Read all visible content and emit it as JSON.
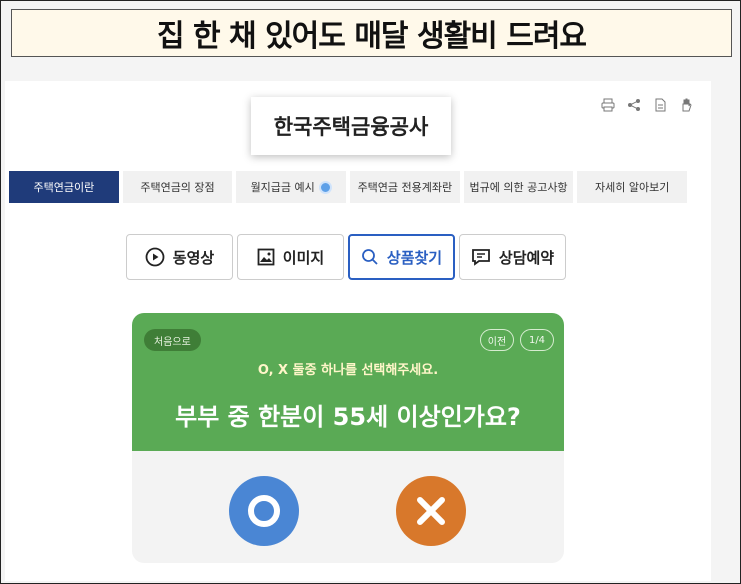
{
  "banner": {
    "text": "집 한 채 있어도 매달 생활비 드려요"
  },
  "site": {
    "logo_text": "한국주택금융공사"
  },
  "tools": [
    {
      "icon": "print-icon"
    },
    {
      "icon": "share-icon"
    },
    {
      "icon": "document-icon"
    },
    {
      "icon": "hand-icon"
    }
  ],
  "nav": {
    "items": [
      {
        "label": "주택연금이란",
        "active": true
      },
      {
        "label": "주택연금의 장점"
      },
      {
        "label": "월지급금 예시",
        "icon": "award-badge-icon"
      },
      {
        "label": "주택연금 전용계좌란"
      },
      {
        "label": "법규에 의한 공고사항"
      },
      {
        "label": "자세히 알아보기"
      }
    ]
  },
  "tabs": [
    {
      "label": "동영상",
      "icon": "play-icon"
    },
    {
      "label": "이미지",
      "icon": "image-icon"
    },
    {
      "label": "상품찾기",
      "icon": "search-icon",
      "active": true
    },
    {
      "label": "상담예약",
      "icon": "chat-icon"
    }
  ],
  "quiz": {
    "restart_label": "처음으로",
    "prev_label": "이전",
    "page_count": "1/4",
    "instruction": "O, X 둘중 하나를 선택해주세요.",
    "question": "부부 중 한분이 55세 이상인가요?",
    "colors": {
      "header": "#5aaa55",
      "o": "#4a86d4",
      "x": "#d8782b"
    }
  }
}
